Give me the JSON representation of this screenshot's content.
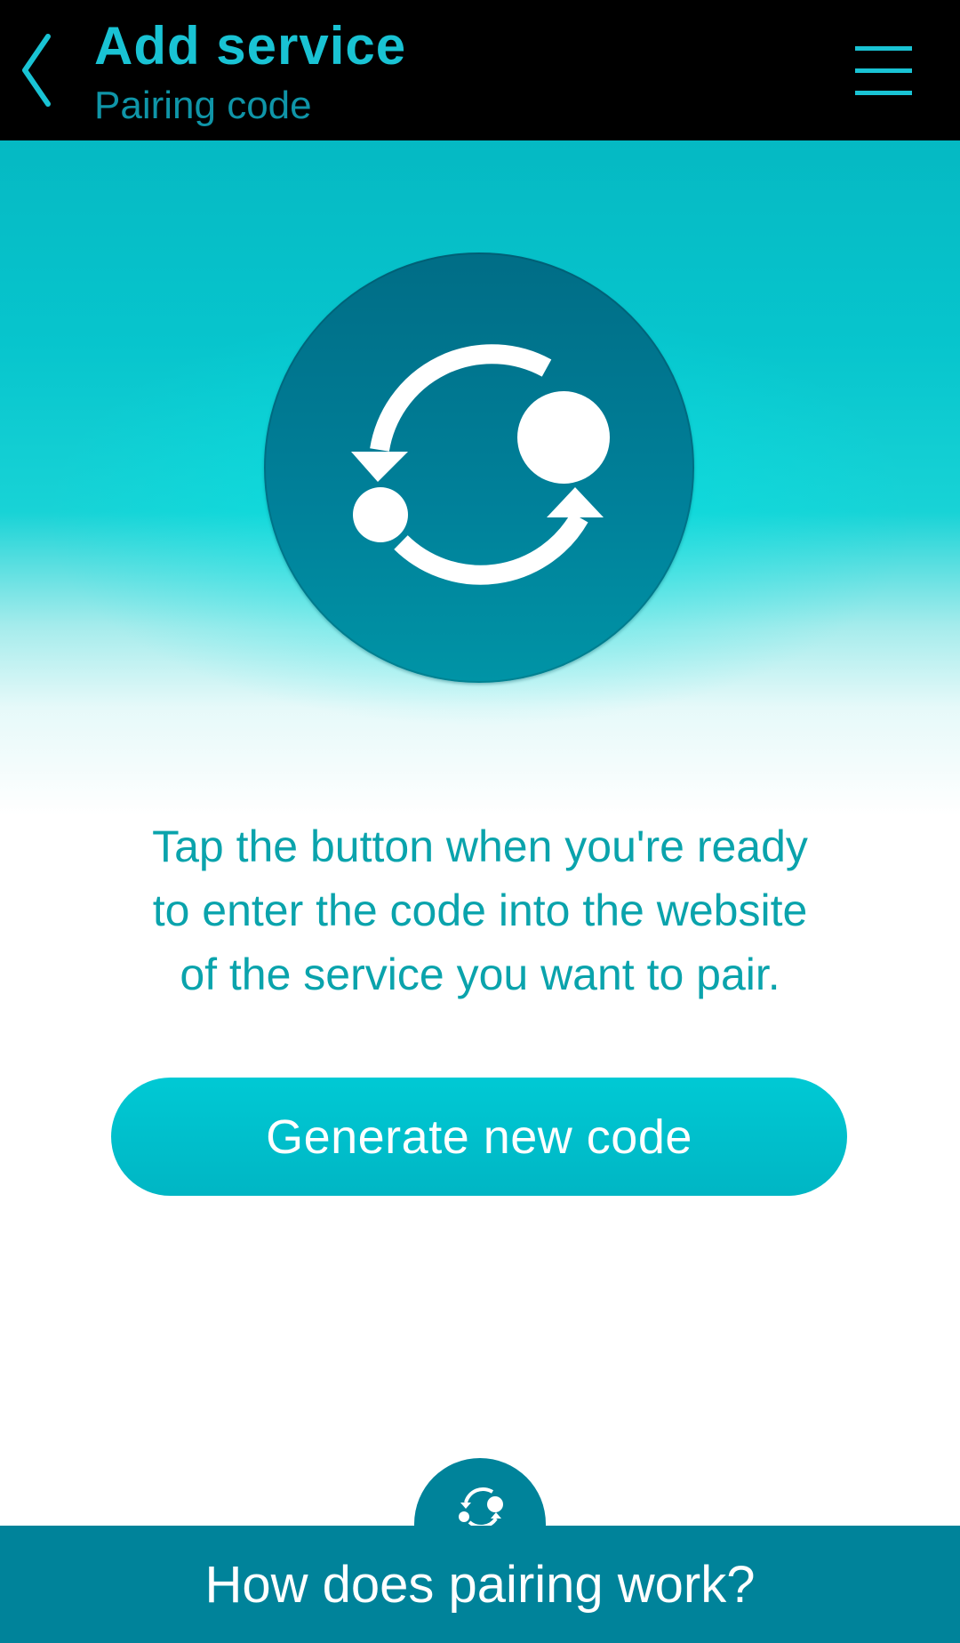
{
  "header": {
    "title": "Add service",
    "subtitle": "Pairing code",
    "back_icon": "chevron-left-icon",
    "menu_icon": "hamburger-menu-icon"
  },
  "hero": {
    "icon": "pairing-sync-icon"
  },
  "instructions": {
    "line1": "Tap the button when you're ready",
    "line2": "to enter the code into the website",
    "line3": "of the service you want to pair."
  },
  "generate_button": {
    "label": "Generate new code"
  },
  "footer": {
    "label": "How does pairing work?",
    "icon": "pairing-sync-icon"
  },
  "colors": {
    "accent": "#19c3d4",
    "dark_teal": "#00839a",
    "header_bg": "#000000"
  }
}
